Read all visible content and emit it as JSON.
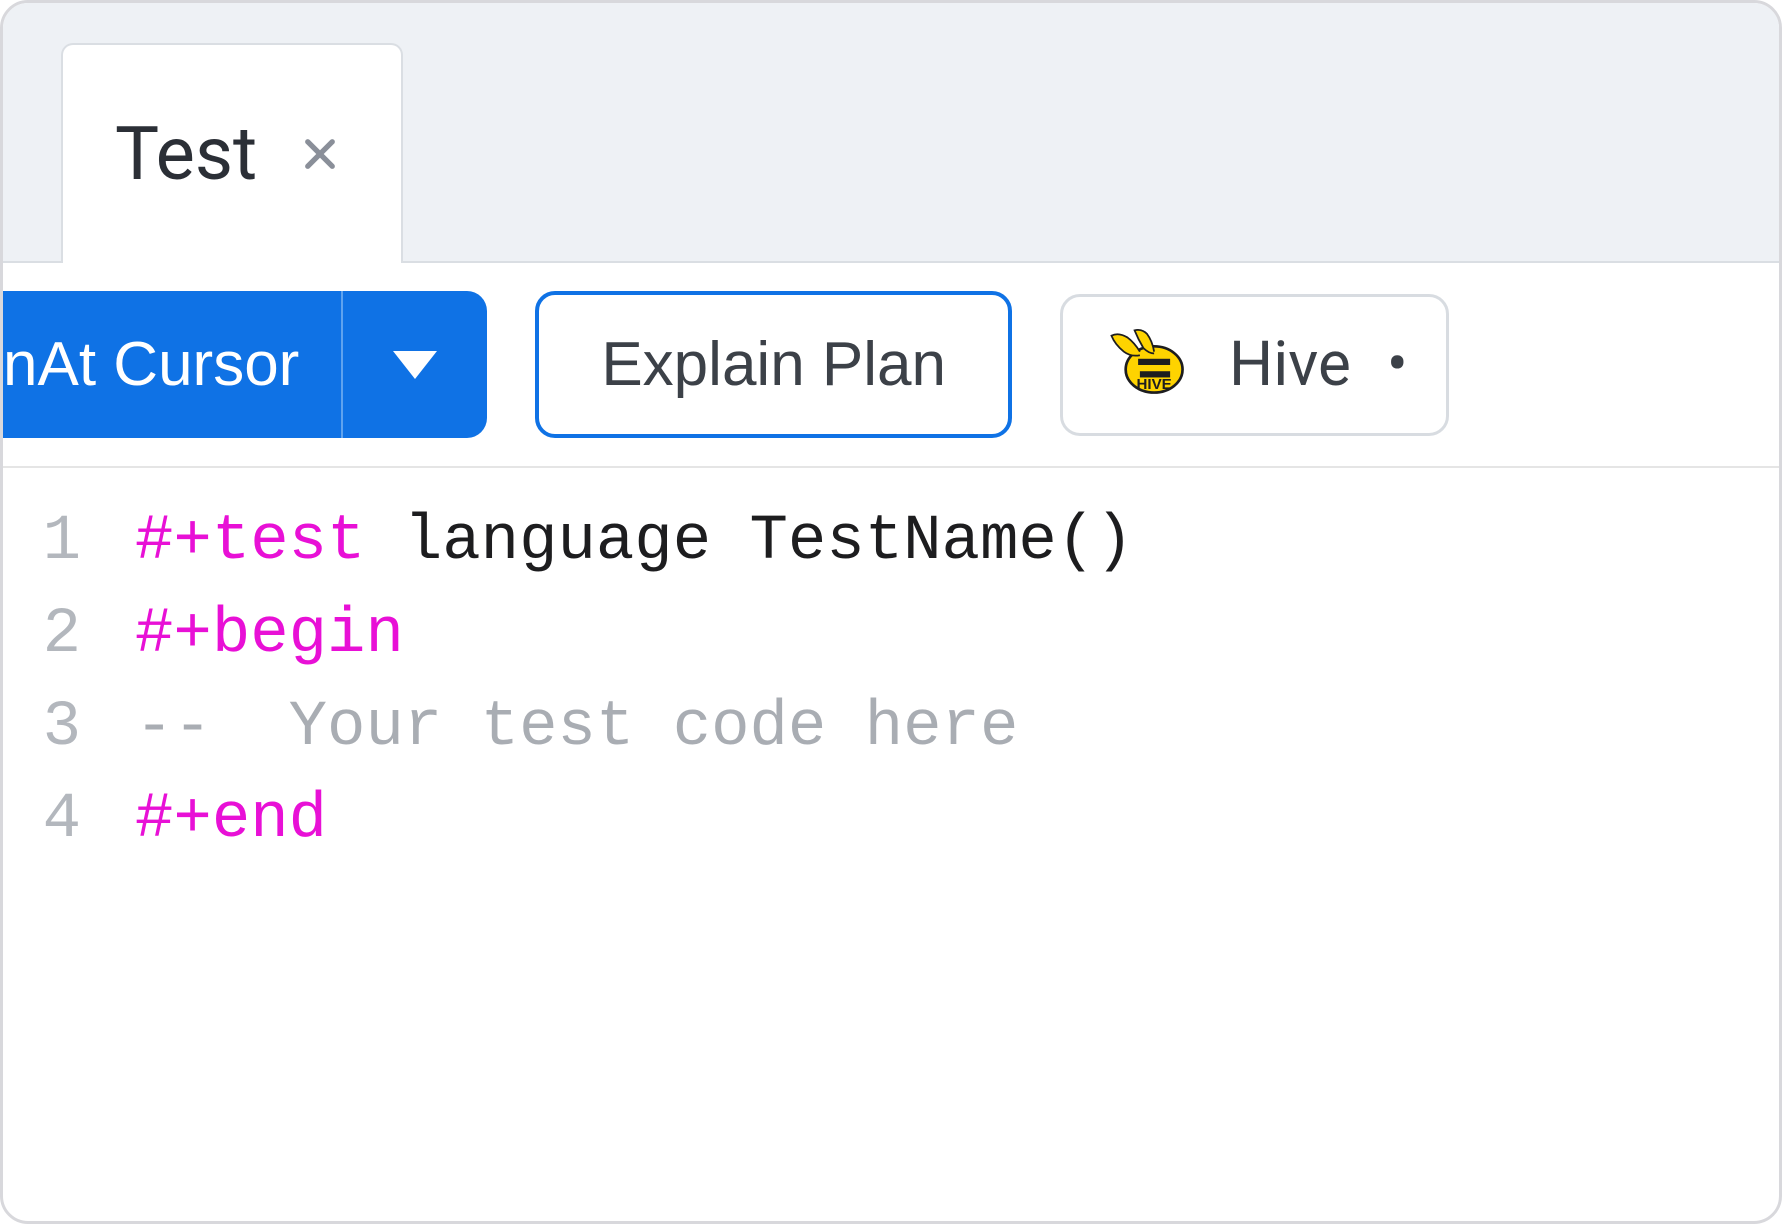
{
  "tab": {
    "label": "Test"
  },
  "toolbar": {
    "run_label": "At Cursor",
    "run_prefix": "n ",
    "explain_label": "Explain Plan",
    "connection_label": "Hive",
    "bullet": "•"
  },
  "editor": {
    "lines": [
      {
        "num": "1",
        "segments": [
          {
            "class": "tok-directive",
            "text": "#+test"
          },
          {
            "class": "",
            "text": " language TestName()"
          }
        ]
      },
      {
        "num": "2",
        "segments": [
          {
            "class": "tok-directive",
            "text": "#+begin"
          }
        ]
      },
      {
        "num": "3",
        "segments": [
          {
            "class": "tok-comment",
            "text": "--  Your test code here"
          }
        ]
      },
      {
        "num": "4",
        "segments": [
          {
            "class": "tok-directive",
            "text": "#+end"
          }
        ]
      }
    ]
  }
}
